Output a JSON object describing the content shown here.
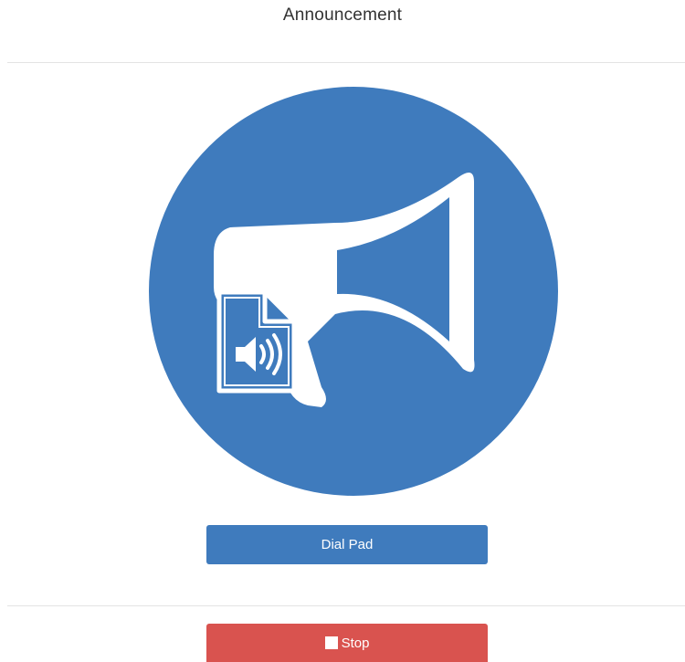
{
  "header": {
    "title": "Announcement"
  },
  "hero": {
    "icon": "megaphone-with-audio-file-icon",
    "color": "#3f7bbd"
  },
  "actions": {
    "dial_pad_label": "Dial Pad",
    "stop_label": "Stop",
    "stop_icon": "stop-square-icon",
    "dial_pad_color": "#3f7bbd",
    "stop_color": "#d9534f"
  }
}
